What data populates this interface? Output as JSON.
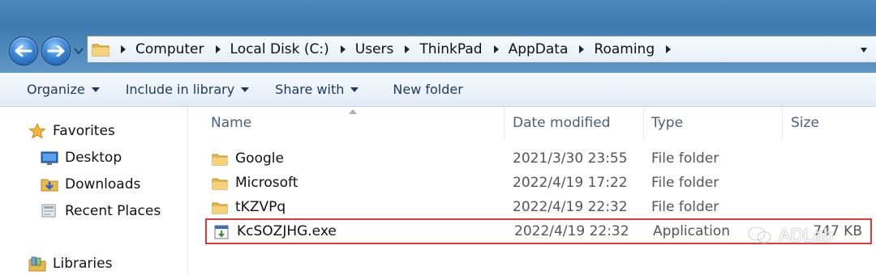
{
  "address_bar": {
    "segments": [
      "Computer",
      "Local Disk (C:)",
      "Users",
      "ThinkPad",
      "AppData",
      "Roaming"
    ]
  },
  "toolbar": {
    "organize_label": "Organize",
    "include_library_label": "Include in library",
    "share_with_label": "Share with",
    "new_folder_label": "New folder"
  },
  "nav_pane": {
    "favorites_label": "Favorites",
    "items": [
      {
        "label": "Desktop",
        "icon": "desktop-icon"
      },
      {
        "label": "Downloads",
        "icon": "downloads-icon"
      },
      {
        "label": "Recent Places",
        "icon": "recent-places-icon"
      }
    ],
    "libraries_label": "Libraries"
  },
  "columns": {
    "name": "Name",
    "date_modified": "Date modified",
    "type": "Type",
    "size": "Size"
  },
  "files": [
    {
      "name": "Google",
      "date": "2021/3/30 23:55",
      "type": "File folder",
      "size": "",
      "icon": "folder-icon"
    },
    {
      "name": "Microsoft",
      "date": "2022/4/19 17:22",
      "type": "File folder",
      "size": "",
      "icon": "folder-icon"
    },
    {
      "name": "tKZVPq",
      "date": "2022/4/19 22:32",
      "type": "File folder",
      "size": "",
      "icon": "folder-icon"
    },
    {
      "name": "KcSOZJHG.exe",
      "date": "2022/4/19 22:32",
      "type": "Application",
      "size": "747 KB",
      "icon": "application-icon",
      "highlighted": true
    }
  ],
  "watermark": {
    "text": "ADLab"
  },
  "colors": {
    "highlight": "#e03a3e",
    "titlebar": "#4f88b9"
  }
}
